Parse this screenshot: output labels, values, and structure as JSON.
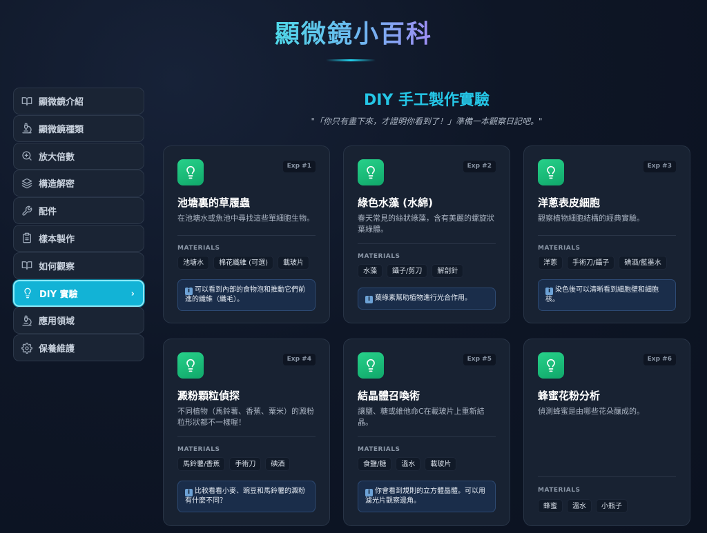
{
  "site_title": "顯微鏡小百科",
  "sidebar": {
    "items": [
      {
        "label": "顯微鏡介紹",
        "icon": "book-open-icon"
      },
      {
        "label": "顯微鏡種類",
        "icon": "microscope-icon"
      },
      {
        "label": "放大倍數",
        "icon": "zoom-in-icon"
      },
      {
        "label": "構造解密",
        "icon": "layers-icon"
      },
      {
        "label": "配件",
        "icon": "wrench-icon"
      },
      {
        "label": "樣本製作",
        "icon": "clipboard-icon"
      },
      {
        "label": "如何觀察",
        "icon": "book-open-icon"
      },
      {
        "label": "DIY 實驗",
        "icon": "lightbulb-icon",
        "active": true
      },
      {
        "label": "應用領域",
        "icon": "microscope-icon"
      },
      {
        "label": "保養維護",
        "icon": "gear-icon"
      }
    ]
  },
  "main": {
    "title": "DIY 手工製作實驗",
    "quote": "\"「你只有畫下來，才證明你看到了！」準備一本觀察日記吧。\"",
    "materials_label": "MATERIALS",
    "accent_color": "#25c6e6",
    "experiments": [
      {
        "exp": "Exp #1",
        "title": "池塘裏的草履蟲",
        "desc": "在池塘水或魚池中尋找這些單細胞生物。",
        "materials": [
          "池塘水",
          "棉花纖維 (可選)",
          "載玻片"
        ],
        "tip": "可以看到內部的食物泡和推動它們前進的纖維（纖毛）。"
      },
      {
        "exp": "Exp #2",
        "title": "綠色水藻 (水綿)",
        "desc": "春天常見的絲狀綠藻，含有美麗的螺旋狀葉綠體。",
        "materials": [
          "水藻",
          "鑷子/剪刀",
          "解剖針"
        ],
        "tip": "葉綠素幫助植物進行光合作用。"
      },
      {
        "exp": "Exp #3",
        "title": "洋蔥表皮細胞",
        "desc": "觀察植物細胞結構的經典實驗。",
        "materials": [
          "洋蔥",
          "手術刀/鑷子",
          "碘酒/藍墨水"
        ],
        "tip": "染色後可以清晰看到細胞壁和細胞核。"
      },
      {
        "exp": "Exp #4",
        "title": "澱粉顆粒偵探",
        "desc": "不同植物（馬鈴薯、香蕉、粟米）的澱粉粒形狀都不一樣喔！",
        "materials": [
          "馬鈴薯/香蕉",
          "手術刀",
          "碘酒"
        ],
        "tip": "比較看看小麥、豌豆和馬鈴薯的澱粉有什麼不同？"
      },
      {
        "exp": "Exp #5",
        "title": "結晶體召喚術",
        "desc": "讓鹽、糖或維他命C在載玻片上重新結晶。",
        "materials": [
          "食鹽/糖",
          "溫水",
          "載玻片"
        ],
        "tip": "你會看到規則的立方體晶體。可以用濾光片觀察邊角。"
      },
      {
        "exp": "Exp #6",
        "title": "蜂蜜花粉分析",
        "desc": "偵測蜂蜜是由哪些花朵釀成的。",
        "materials": [
          "蜂蜜",
          "溫水",
          "小瓶子"
        ],
        "tip": ""
      }
    ]
  }
}
